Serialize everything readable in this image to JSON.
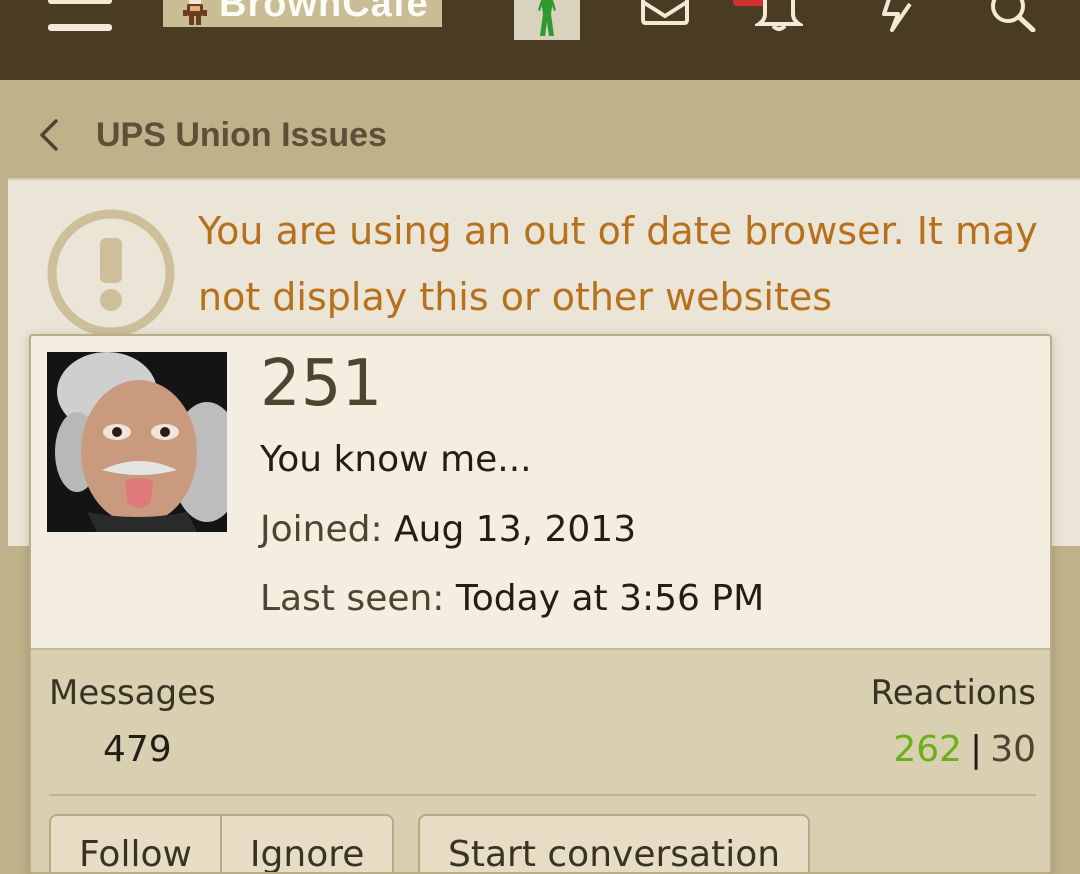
{
  "header": {
    "menu_icon": "hamburger-menu-icon",
    "logo_text": "BrownCafe",
    "icons": [
      "inbox-envelope-icon",
      "alert-bell-icon",
      "whats-new-lightning-icon",
      "search-icon"
    ],
    "alert_badge_color": "#d0312d",
    "bar_color": "#493c22"
  },
  "breadcrumb": {
    "label": "UPS Union Issues",
    "icon": "chevron-left-icon"
  },
  "notice": {
    "text": "You are using an out of date browser. It may not display this or other websites",
    "icon": "exclamation-circle-icon",
    "text_color": "#b7701b"
  },
  "member": {
    "username": "251",
    "user_title": "You know me...",
    "joined_label": "Joined:",
    "joined_value": "Aug 13, 2013",
    "last_seen_label": "Last seen:",
    "last_seen_value": "Today at 3:56 PM",
    "messages_label": "Messages",
    "messages_value": "479",
    "reactions_label": "Reactions",
    "reactions_positive": "262",
    "reactions_separator": "|",
    "reactions_negative": "30",
    "positive_color": "#6bb01a"
  },
  "actions": {
    "follow_label": "Follow",
    "ignore_label": "Ignore",
    "conversation_label": "Start conversation"
  }
}
